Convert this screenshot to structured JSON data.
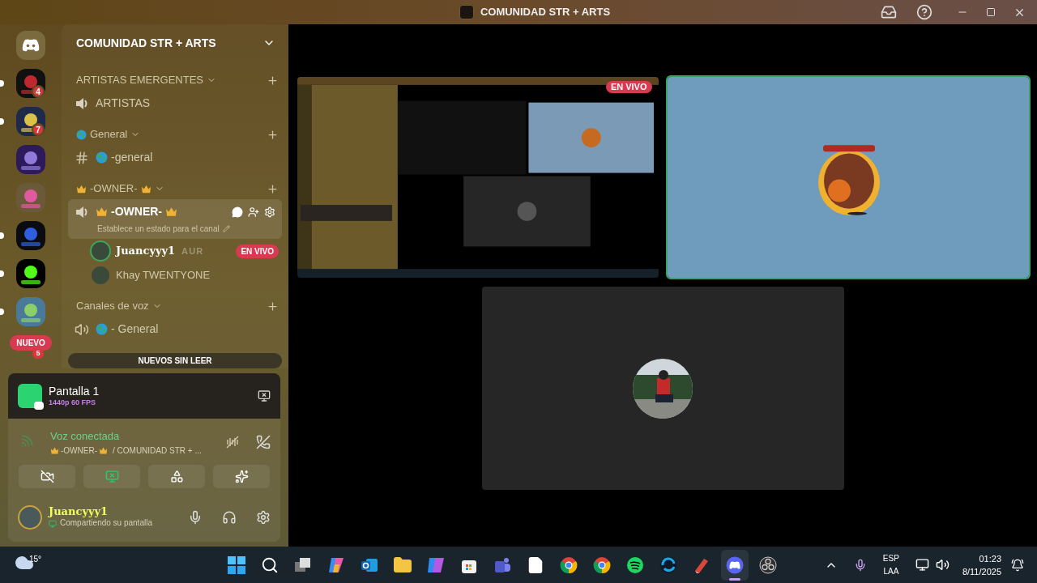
{
  "window": {
    "title": "COMUNIDAD STR + ARTS"
  },
  "servers": [
    {
      "unread": true,
      "badge": "4"
    },
    {
      "unread": true,
      "badge": "7"
    },
    {
      "unread": false
    },
    {
      "unread": false
    },
    {
      "unread": true
    },
    {
      "unread": true
    },
    {
      "unread": true
    }
  ],
  "new_pill": {
    "label": "NUEVO",
    "badge": "5"
  },
  "server_name": "COMUNIDAD STR + ARTS",
  "channels": [
    {
      "kind": "category",
      "name": "ARTISTAS EMERGENTES"
    },
    {
      "kind": "stage",
      "name": "ARTISTAS",
      "selected": false
    },
    {
      "kind": "category",
      "name": "General",
      "globe_icon": true
    },
    {
      "kind": "text",
      "name": "-general",
      "globe_icon": true,
      "selected": false
    },
    {
      "kind": "category",
      "name": "-OWNER-",
      "crown_icons": true
    },
    {
      "kind": "stage",
      "name": "-OWNER-",
      "crown_icons": true,
      "selected": true,
      "status": "Establece un estado para el canal",
      "members": [
        {
          "name": "Juancyyy1",
          "tag": "AUR",
          "live": true,
          "live_label": "EN VIVO"
        },
        {
          "name": "Khay TWENTYONE",
          "live": false
        }
      ]
    },
    {
      "kind": "category",
      "name": "Canales de voz"
    },
    {
      "kind": "voice",
      "name": "- General",
      "globe_icon": true,
      "selected": false
    }
  ],
  "unread_bar": "NUEVOS SIN LEER",
  "stream": {
    "title": "Pantalla 1",
    "quality": "1440p 60 FPS"
  },
  "voice": {
    "status": "Voz conectada",
    "channel": "-OWNER-",
    "server": "/ COMUNIDAD STR + ...",
    "buttons": [
      {
        "kind": "camera",
        "active": false
      },
      {
        "kind": "screen",
        "active": true
      },
      {
        "kind": "activities",
        "active": false
      },
      {
        "kind": "soundboard",
        "active": false
      }
    ]
  },
  "user": {
    "name": "Juancyyy1",
    "status": "Compartiendo su pantalla"
  },
  "tiles": [
    {
      "kind": "stream",
      "live_label": "EN VIVO",
      "speaking": false
    },
    {
      "kind": "camera",
      "speaking": true
    },
    {
      "kind": "avatar",
      "speaking": false
    }
  ],
  "taskbar": {
    "weather": "15°",
    "apps": [
      {
        "kind": "start",
        "active": false
      },
      {
        "kind": "search",
        "active": false
      },
      {
        "kind": "taskview",
        "active": false
      },
      {
        "kind": "copilot",
        "active": false
      },
      {
        "kind": "outlook",
        "active": false
      },
      {
        "kind": "folder",
        "active": false
      },
      {
        "kind": "m365",
        "active": false
      },
      {
        "kind": "store",
        "active": false
      },
      {
        "kind": "teams",
        "active": false
      },
      {
        "kind": "file",
        "active": false
      },
      {
        "kind": "chrome",
        "active": false
      },
      {
        "kind": "chrome",
        "active": false
      },
      {
        "kind": "spotify",
        "active": false
      },
      {
        "kind": "globe",
        "active": false
      },
      {
        "kind": "brush",
        "active": false
      },
      {
        "kind": "discord",
        "active": true
      },
      {
        "kind": "obs",
        "active": false
      }
    ],
    "language": "ESP",
    "layout": "LAA",
    "time": "01:23",
    "date": "8/11/2025"
  }
}
